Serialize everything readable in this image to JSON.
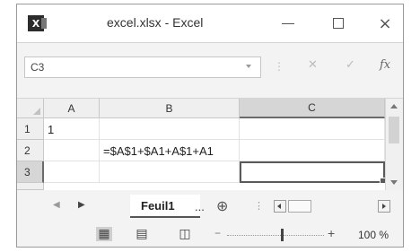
{
  "window": {
    "title": "excel.xlsx - Excel",
    "app_icon_letter": "X",
    "controls": {
      "minimize": "minimize",
      "maximize": "maximize",
      "close": "×"
    }
  },
  "formula_bar": {
    "name_box": "C3",
    "separator": "⋮",
    "cancel_icon": "✕",
    "enter_icon": "✓",
    "fx_label": "fx",
    "formula": ""
  },
  "grid": {
    "columns": [
      "A",
      "B",
      "C"
    ],
    "rows": [
      "1",
      "2",
      "3"
    ],
    "cells": {
      "A1": "1",
      "B2": "=$A$1+$A1+A$1+A1"
    },
    "selected_cell": "C3",
    "selection_color": "#5a5a5a"
  },
  "sheet_tabs": {
    "nav_prev": "◀",
    "nav_next": "▶",
    "active_tab": "Feuil1",
    "more": "...",
    "add_sheet": "⊕",
    "dots": "⋮"
  },
  "status_bar": {
    "zoom_minus": "−",
    "zoom_plus": "+",
    "zoom_percent": "100 %",
    "zoom_level": 1.0
  }
}
